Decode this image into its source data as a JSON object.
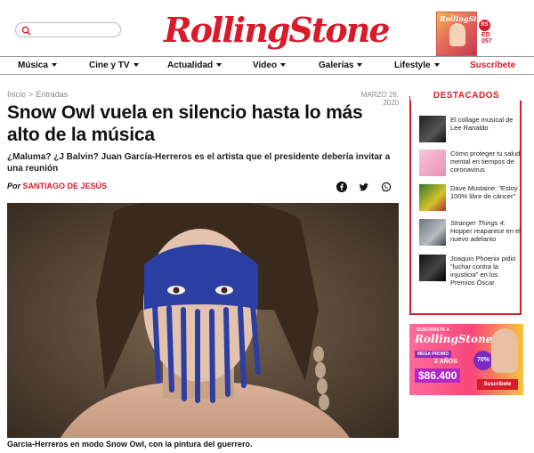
{
  "header": {
    "search_placeholder": "",
    "logo_text": "RollingStone",
    "magazine_cover_title": "RollingStone",
    "issue_badge": "RS",
    "issue_label": "ED 057"
  },
  "nav": {
    "items": [
      {
        "label": "Música"
      },
      {
        "label": "Cine y TV"
      },
      {
        "label": "Actualidad"
      },
      {
        "label": "Video"
      },
      {
        "label": "Galerías"
      },
      {
        "label": "Lifestyle"
      }
    ],
    "subscribe_label": "Suscríbete"
  },
  "article": {
    "breadcrumb": {
      "home": "Inicio",
      "section": "Entradas",
      "separator": ">"
    },
    "date": "MARZO 26, 2020",
    "title": "Snow Owl vuela en silencio hasta lo más alto de la música",
    "subtitle": "¿Maluma? ¿J Balvin? Juan García-Herreros es el artista que el presidente debería invitar a una reunión",
    "byline_prefix": "Por",
    "author": "SANTIAGO DE JESÚS",
    "caption": "García-Herreros en modo Snow Owl, con la pintura del guerrero."
  },
  "share": {
    "icons": [
      "facebook-icon",
      "twitter-icon",
      "whatsapp-icon"
    ]
  },
  "sidebar": {
    "heading": "DESTACADOS",
    "items": [
      {
        "text": "El collage musical de Lee Ranaldo"
      },
      {
        "text": "Cómo proteger tu salud mental en tiempos de coronavirus"
      },
      {
        "text": "Dave Mustaine: \"Estoy 100% libre de cáncer\""
      },
      {
        "text_italic": "Stranger Things 4",
        "text": ": Hopper reaparece en el nuevo adelanto"
      },
      {
        "text": "Joaquin Phoenix pidió \"luchar contra la injusticia\" en los Premios Óscar"
      }
    ]
  },
  "ad": {
    "small_text": "SUSCRÍBETE A",
    "brand": "RollingStone",
    "promo_label": "MEGA PROMO",
    "years_label": "2 AÑOS",
    "price": "$86.400",
    "discount": "70%",
    "cta_label": "Suscríbete"
  },
  "colors": {
    "brand_red": "#d91a2a",
    "text": "#111111",
    "muted": "#888888"
  }
}
